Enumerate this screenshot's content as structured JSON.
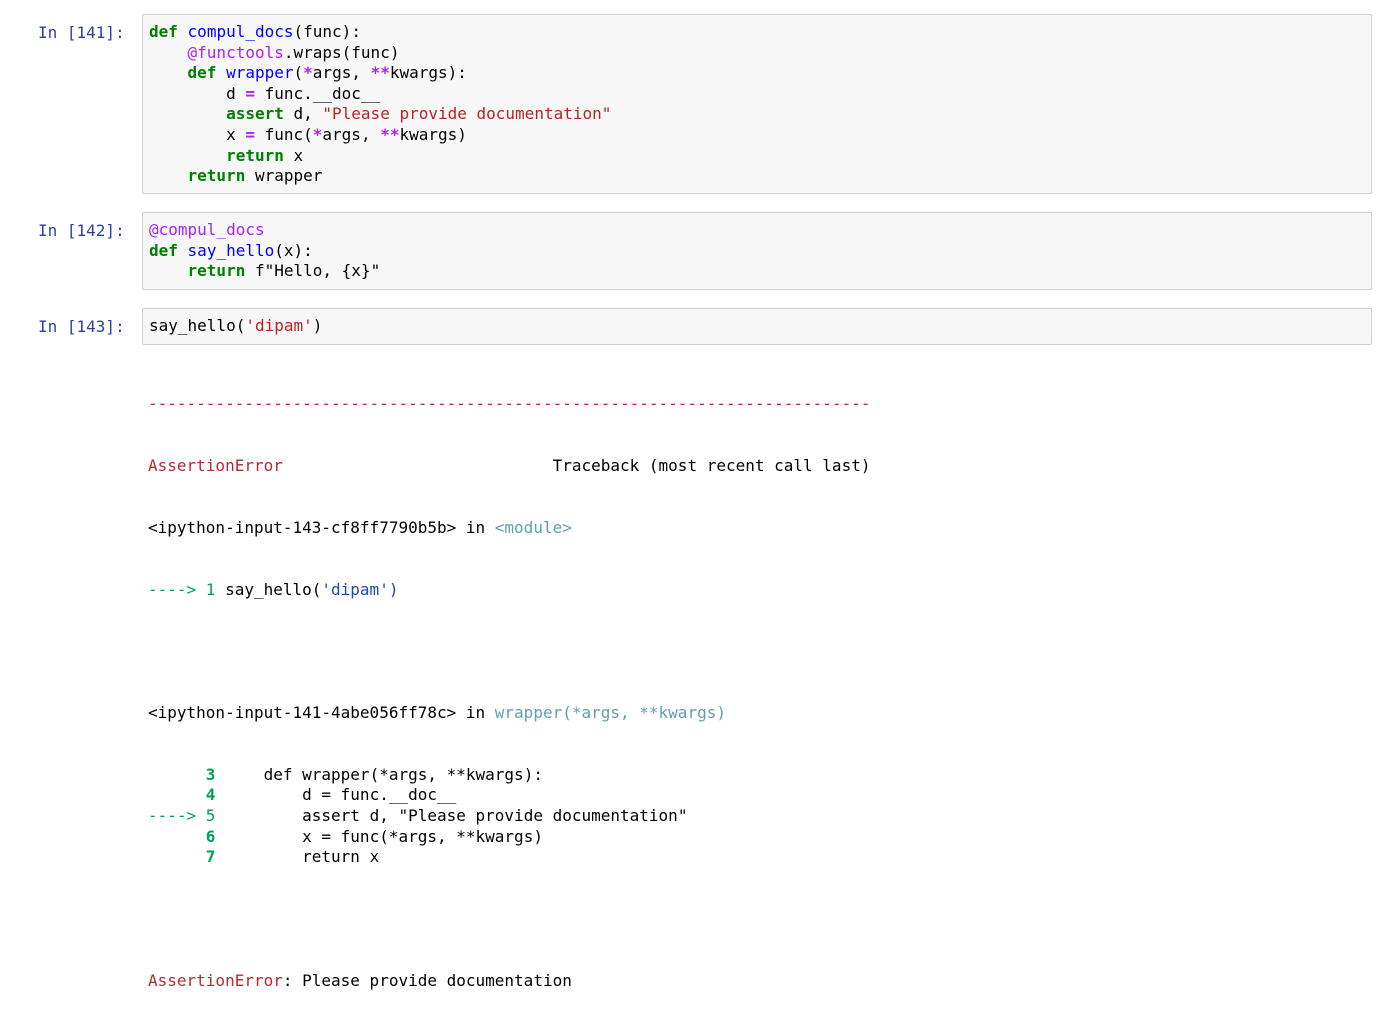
{
  "cells": [
    {
      "prompt": "In [141]:",
      "code_lines": [
        [
          {
            "t": "def",
            "c": "kw"
          },
          {
            "t": " "
          },
          {
            "t": "compul_docs",
            "c": "fn"
          },
          {
            "t": "(func):"
          }
        ],
        [
          {
            "t": "    "
          },
          {
            "t": "@functools",
            "c": "dec"
          },
          {
            "t": ".wraps(func)"
          }
        ],
        [
          {
            "t": "    "
          },
          {
            "t": "def",
            "c": "kw"
          },
          {
            "t": " "
          },
          {
            "t": "wrapper",
            "c": "fn"
          },
          {
            "t": "("
          },
          {
            "t": "*",
            "c": "op"
          },
          {
            "t": "args, "
          },
          {
            "t": "**",
            "c": "op"
          },
          {
            "t": "kwargs):"
          }
        ],
        [
          {
            "t": "        d "
          },
          {
            "t": "=",
            "c": "op"
          },
          {
            "t": " func.__doc__"
          }
        ],
        [
          {
            "t": "        "
          },
          {
            "t": "assert",
            "c": "kw"
          },
          {
            "t": " d, "
          },
          {
            "t": "\"Please provide documentation\"",
            "c": "str"
          }
        ],
        [
          {
            "t": "        x "
          },
          {
            "t": "=",
            "c": "op"
          },
          {
            "t": " func("
          },
          {
            "t": "*",
            "c": "op"
          },
          {
            "t": "args, "
          },
          {
            "t": "**",
            "c": "op"
          },
          {
            "t": "kwargs)"
          }
        ],
        [
          {
            "t": "        "
          },
          {
            "t": "return",
            "c": "kw"
          },
          {
            "t": " x"
          }
        ],
        [
          {
            "t": "    "
          },
          {
            "t": "return",
            "c": "kw"
          },
          {
            "t": " wrapper"
          }
        ]
      ]
    },
    {
      "prompt": "In [142]:",
      "code_lines": [
        [
          {
            "t": "@compul_docs",
            "c": "dec"
          }
        ],
        [
          {
            "t": "def",
            "c": "kw"
          },
          {
            "t": " "
          },
          {
            "t": "say_hello",
            "c": "fn"
          },
          {
            "t": "(x):"
          }
        ],
        [
          {
            "t": "    "
          },
          {
            "t": "return",
            "c": "kw"
          },
          {
            "t": " f"
          },
          {
            "t": "\"Hello, "
          },
          {
            "t": "{x}"
          },
          {
            "t": "\"",
            "c": ""
          }
        ]
      ]
    },
    {
      "prompt": "In [143]:",
      "code_lines": [
        [
          {
            "t": "say_hello("
          },
          {
            "t": "'dipam'",
            "c": "str"
          },
          {
            "t": ")"
          }
        ]
      ]
    }
  ],
  "traceback": {
    "separator": "---------------------------------------------------------------------------",
    "error_name": "AssertionError",
    "traceback_header": "Traceback (most recent call last)",
    "frame1_file": "<ipython-input-143-cf8ff7790b5b>",
    "frame1_in": " in ",
    "frame1_module": "<module>",
    "frame1_arrow": "----> 1 ",
    "frame1_code": "say_hello(",
    "frame1_arg": "'dipam'",
    "frame1_close": ")",
    "frame2_file": "<ipython-input-141-4abe056ff78c>",
    "frame2_in": " in ",
    "frame2_func": "wrapper(*args, **kwargs)",
    "lines": [
      {
        "prefix": "      ",
        "num": "3",
        "code": "     def wrapper(*args, **kwargs):",
        "current": false
      },
      {
        "prefix": "      ",
        "num": "4",
        "code": "         d = func.__doc__",
        "current": false
      },
      {
        "prefix": "----> ",
        "num": "5",
        "code": "         assert d, \"Please provide documentation\"",
        "current": true
      },
      {
        "prefix": "      ",
        "num": "6",
        "code": "         x = func(*args, **kwargs)",
        "current": false
      },
      {
        "prefix": "      ",
        "num": "7",
        "code": "         return x",
        "current": false
      }
    ],
    "final_error_name": "AssertionError",
    "final_error_msg": ": Please provide documentation"
  }
}
